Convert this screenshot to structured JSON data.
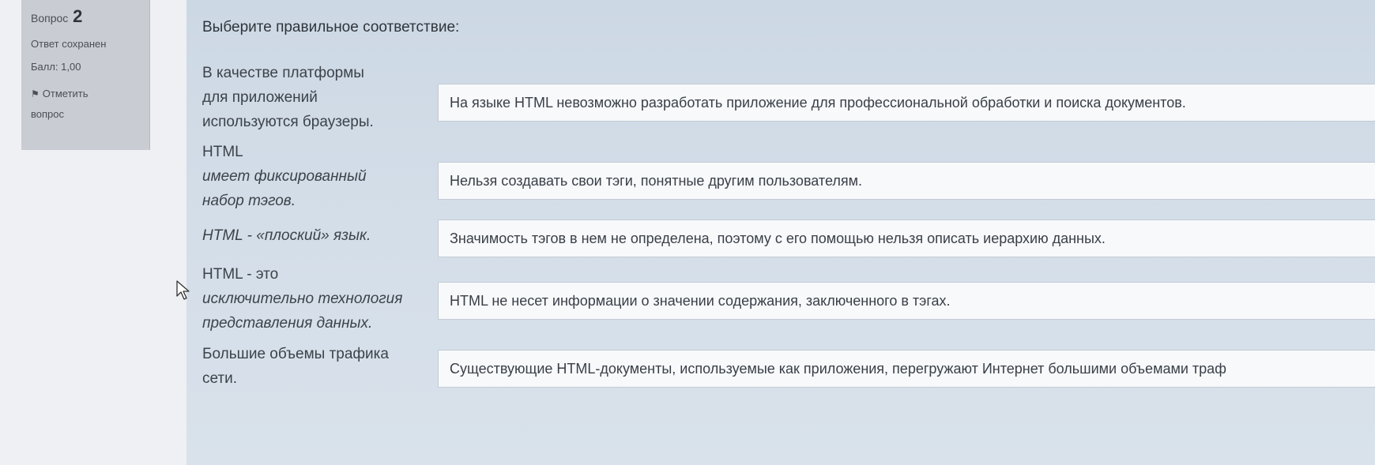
{
  "info": {
    "question_label": "Вопрос",
    "question_number": "2",
    "status": "Ответ сохранен",
    "score": "Балл: 1,00",
    "flag_label": "Отметить",
    "flag_label2": "вопрос"
  },
  "prompt": "Выберите правильное соответствие:",
  "rows": [
    {
      "term_lines": [
        "В качестве платформы",
        "для приложений",
        "используются браузеры."
      ],
      "answer": "На языке HTML невозможно разработать приложение для профессиональной обработки и поиска документов."
    },
    {
      "term_lines": [
        "HTML",
        "имеет фиксированный",
        "набор тэгов."
      ],
      "answer": "Нельзя создавать свои тэги, понятные другим пользователям."
    },
    {
      "term_lines": [
        "HTML - «плоский» язык."
      ],
      "answer": "Значимость тэгов в нем не определена, поэтому с его помощью нельзя описать иерархию данных."
    },
    {
      "term_lines": [
        "HTML - это",
        "исключительно технология",
        "представления данных."
      ],
      "answer": "HTML не несет информации о значении содержания, заключенного в тэгах."
    },
    {
      "term_lines": [
        "Большие объемы трафика",
        "сети."
      ],
      "answer": "Существующие HTML-документы, используемые как приложения, перегружают Интернет большими объемами траф"
    }
  ]
}
